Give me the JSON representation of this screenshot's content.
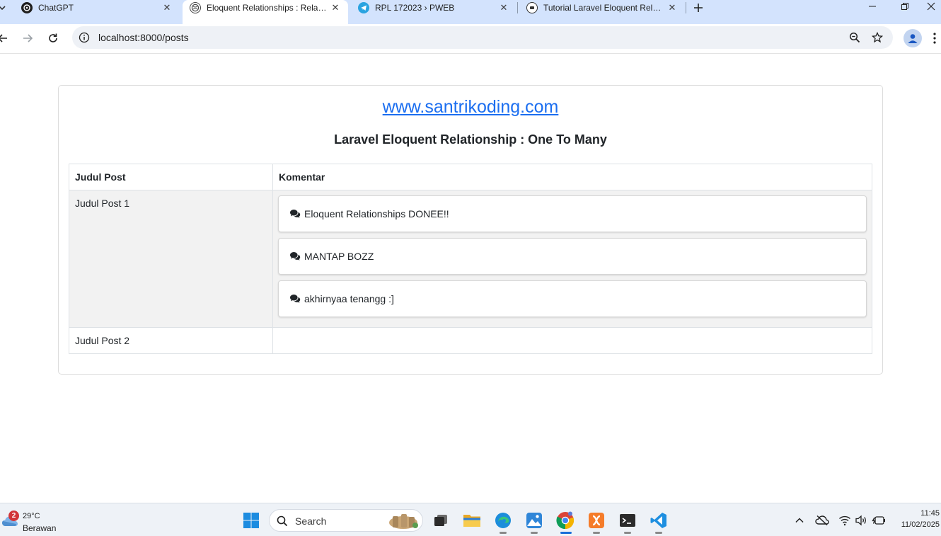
{
  "browser": {
    "tabs": [
      {
        "title": "ChatGPT",
        "icon": "chatgpt-icon"
      },
      {
        "title": "Eloquent Relationships : Relasi O",
        "icon": "globe-icon",
        "active": true
      },
      {
        "title": "RPL 172023 › PWEB",
        "icon": "telegram-icon"
      },
      {
        "title": "Tutorial Laravel Eloquent Relatio",
        "icon": "santrikoding-icon"
      }
    ],
    "url": "localhost:8000/posts"
  },
  "page": {
    "site_link": "www.santrikoding.com",
    "subtitle": "Laravel Eloquent Relationship : One To Many",
    "table": {
      "headers": [
        "Judul Post",
        "Komentar"
      ],
      "rows": [
        {
          "title": "Judul Post 1",
          "comments": [
            "Eloquent Relationships DONEE!!",
            "MANTAP BOZZ",
            "akhirnyaa tenangg :]"
          ]
        },
        {
          "title": "Judul Post 2",
          "comments": []
        }
      ]
    }
  },
  "taskbar": {
    "weather": {
      "badge": "2",
      "temp": "29°C",
      "condition": "Berawan"
    },
    "search_label": "Search",
    "clock": {
      "time": "11:45",
      "date": "11/02/2025"
    }
  },
  "colors": {
    "link": "#1b6ef0",
    "tabstrip": "#d3e3fd",
    "striped_row": "#f2f2f2"
  }
}
